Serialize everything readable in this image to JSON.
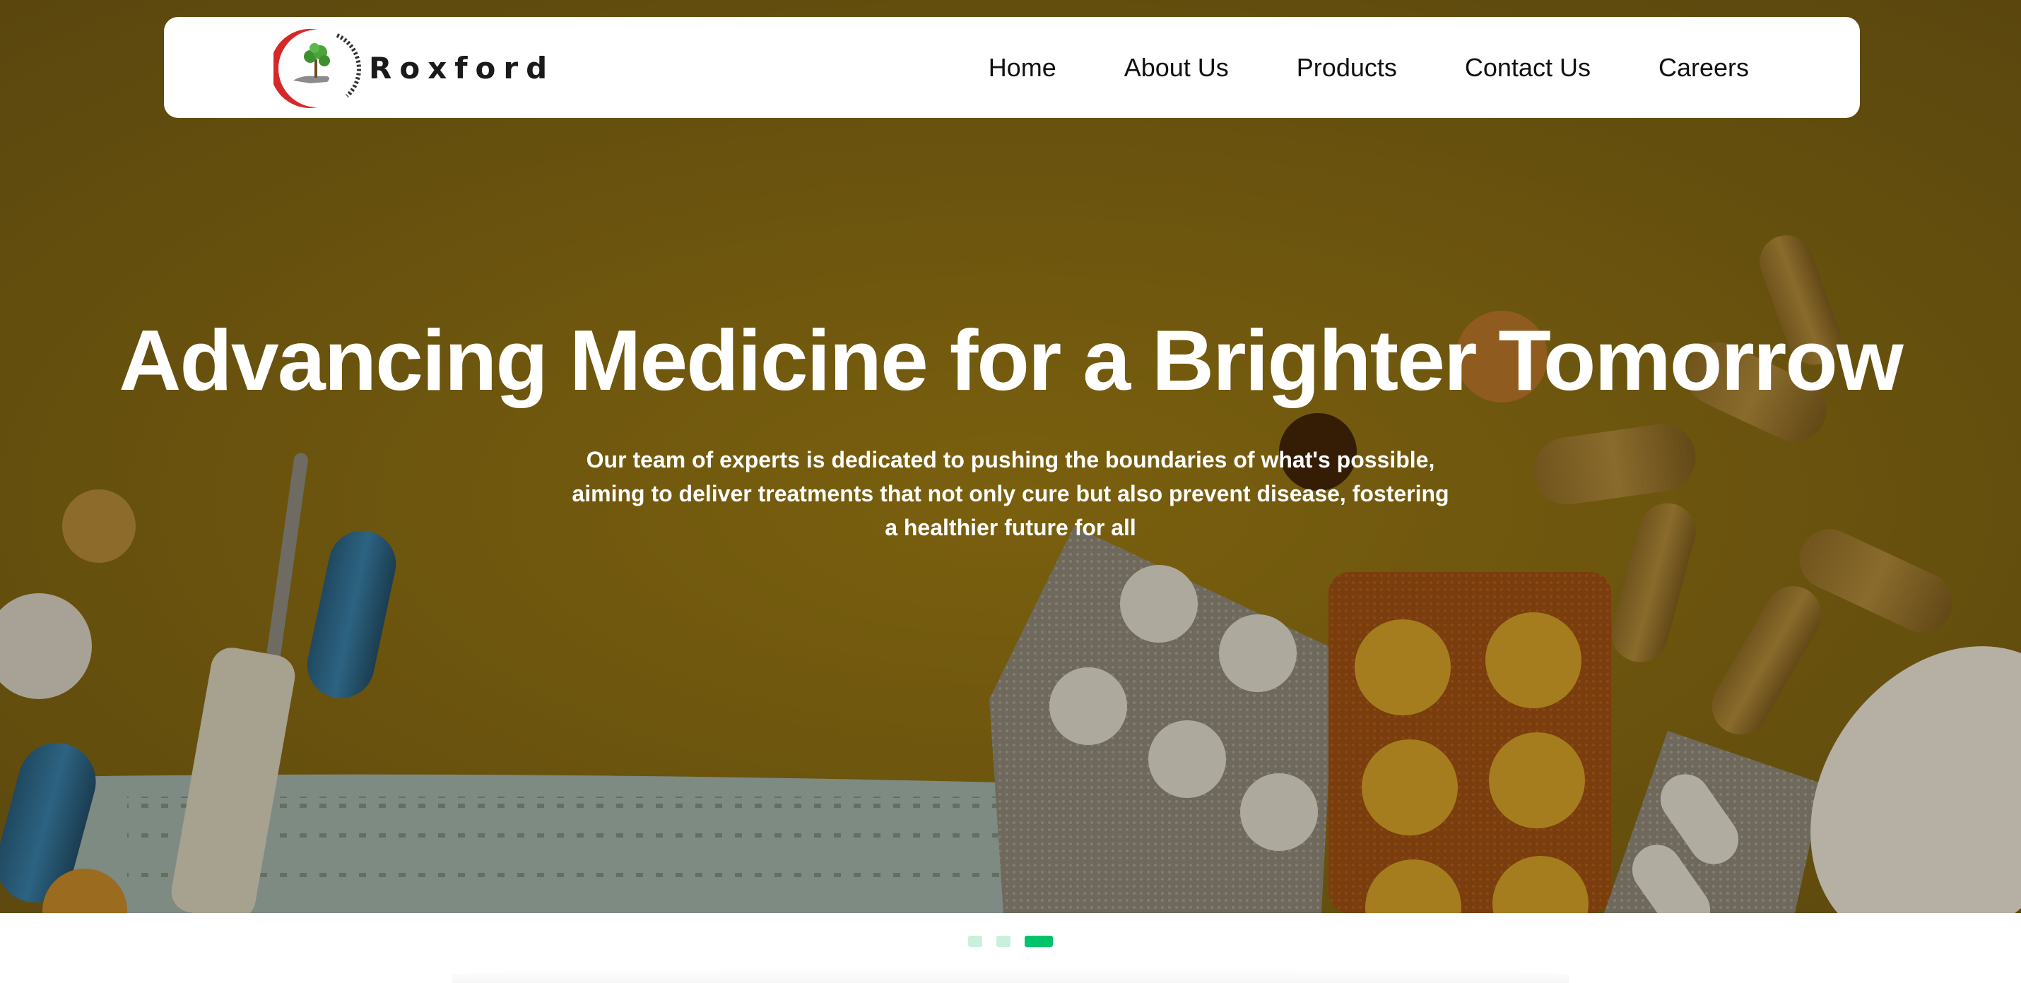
{
  "brand": {
    "name": "Roxford",
    "ring_text": "Roxford Healthcare"
  },
  "nav": {
    "items": [
      {
        "label": "Home"
      },
      {
        "label": "About Us"
      },
      {
        "label": "Products"
      },
      {
        "label": "Contact Us"
      },
      {
        "label": "Careers"
      }
    ]
  },
  "hero": {
    "title": "Advancing Medicine for a Brighter Tomorrow",
    "subtitle": "Our team of experts is dedicated to pushing the boundaries of what's possible, aiming to deliver treatments that not only cure but also prevent disease, fostering a healthier future for all",
    "background": "pills, capsules, thermometer and medical mask on mustard yellow surface"
  },
  "carousel": {
    "slide_count": 3,
    "active_index": 2
  },
  "colors": {
    "hero_bg": "#6b5619",
    "accent_green": "#00c36a",
    "dot_inactive": "#c9f0dc",
    "logo_red": "#d62828",
    "nav_text": "#111111"
  }
}
